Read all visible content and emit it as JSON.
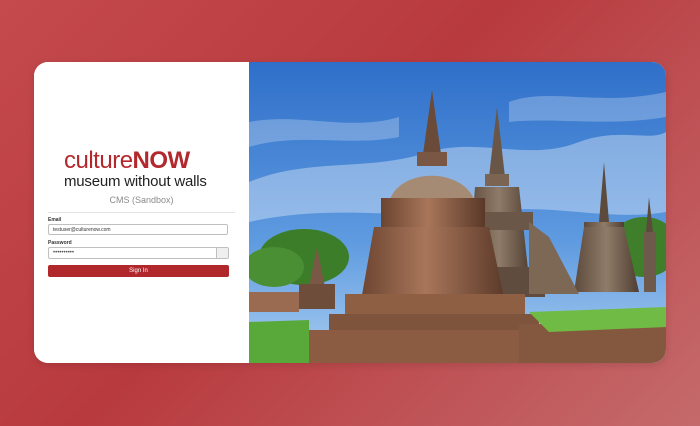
{
  "brand": {
    "logo_part1": "culture",
    "logo_part2": "NOW",
    "tagline": "museum without walls",
    "subtitle": "CMS (Sandbox)"
  },
  "form": {
    "email_label": "Email",
    "email_value": "testuser@culturenow.com",
    "password_label": "Password",
    "password_value": "••••••••••",
    "signin_label": "Sign In"
  },
  "colors": {
    "accent": "#b0282c",
    "background": "#c44a4d"
  },
  "hero_image": {
    "subject": "temple-stupas-photo"
  }
}
